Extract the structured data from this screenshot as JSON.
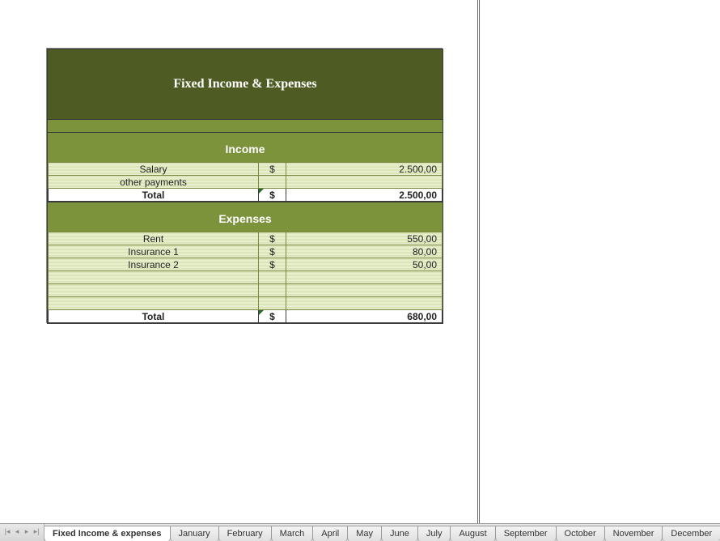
{
  "title": "Fixed Income & Expenses",
  "income": {
    "header": "Income",
    "rows": [
      {
        "label": "Salary",
        "currency": "$",
        "value": "2.500,00"
      },
      {
        "label": "other payments",
        "currency": "",
        "value": ""
      }
    ],
    "total": {
      "label": "Total",
      "currency": "$",
      "value": "2.500,00"
    }
  },
  "expenses": {
    "header": "Expenses",
    "rows": [
      {
        "label": "Rent",
        "currency": "$",
        "value": "550,00"
      },
      {
        "label": "Insurance 1",
        "currency": "$",
        "value": "80,00"
      },
      {
        "label": "Insurance 2",
        "currency": "$",
        "value": "50,00"
      },
      {
        "label": "",
        "currency": "",
        "value": ""
      },
      {
        "label": "",
        "currency": "",
        "value": ""
      },
      {
        "label": "",
        "currency": "",
        "value": ""
      }
    ],
    "total": {
      "label": "Total",
      "currency": "$",
      "value": "680,00"
    }
  },
  "tabs": {
    "active": "Fixed Income & expenses",
    "items": [
      "Fixed Income & expenses",
      "January",
      "February",
      "March",
      "April",
      "May",
      "June",
      "July",
      "August",
      "September",
      "October",
      "November",
      "December"
    ],
    "add": "+"
  }
}
